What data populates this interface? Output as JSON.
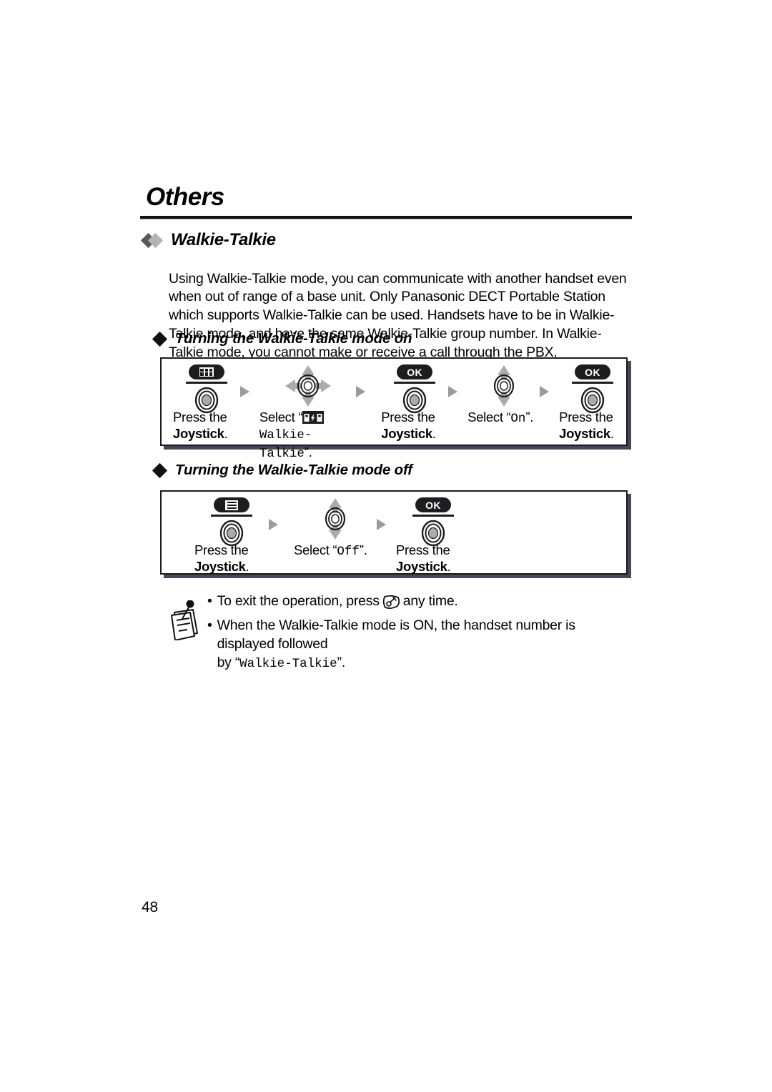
{
  "page": {
    "chapter_title": "Others",
    "page_number": "48"
  },
  "section": {
    "title": "Walkie-Talkie",
    "body": "Using Walkie-Talkie mode, you can communicate with another handset even when out of range of a base unit. Only Panasonic DECT Portable Station which supports Walkie-Talkie can be used. Handsets have to be in Walkie-Talkie mode, and have the same Walkie-Talkie group number. In Walkie-Talkie mode, you cannot make or receive a call through the PBX."
  },
  "procedure_on": {
    "heading": "Turning the Walkie-Talkie mode on",
    "steps": [
      {
        "icon": "menu-grid-button-icon",
        "glyph": "button-joystick",
        "caption_line1": "Press the",
        "caption_line2_bold": "Joystick",
        "caption_line2_tail": "."
      },
      {
        "icon": "joystick-four-arrows-icon",
        "glyph": "joystick-four-way",
        "select_prefix": "Select “",
        "inline_icon": "walkie-talkie-glyph",
        "select_value": "Walkie-Talkie",
        "select_suffix": "”."
      },
      {
        "icon": "ok-button-icon",
        "glyph": "button-joystick",
        "caption_line1": "Press the",
        "caption_line2_bold": "Joystick",
        "caption_line2_tail": "."
      },
      {
        "icon": "joystick-vertical-arrows-icon",
        "glyph": "joystick-vertical",
        "select_prefix": "Select “",
        "select_value": "On",
        "select_suffix": "”."
      },
      {
        "icon": "ok-button-icon",
        "glyph": "button-joystick",
        "caption_line1": "Press the",
        "caption_line2_bold": "Joystick",
        "caption_line2_tail": "."
      }
    ]
  },
  "procedure_off": {
    "heading": "Turning the Walkie-Talkie mode off",
    "steps": [
      {
        "icon": "menu-list-button-icon",
        "glyph": "button-joystick",
        "caption_line1": "Press the",
        "caption_line2_bold": "Joystick",
        "caption_line2_tail": "."
      },
      {
        "icon": "joystick-vertical-arrows-icon",
        "glyph": "joystick-vertical",
        "select_prefix": "Select “",
        "select_value": "Off",
        "select_suffix": "”."
      },
      {
        "icon": "ok-button-icon",
        "glyph": "button-joystick",
        "caption_line1": "Press the",
        "caption_line2_bold": "Joystick",
        "caption_line2_tail": "."
      }
    ]
  },
  "labels": {
    "ok": "OK",
    "bullet": "•"
  },
  "notes": {
    "icon": "memo-note-icon",
    "item1_pre": "To exit the operation, press",
    "item1_icon": "power-off-button-icon",
    "item1_post": "any time.",
    "item2_line1": "When the Walkie-Talkie mode is ON, the handset number is displayed followed",
    "item2_line2_pre": "by “",
    "item2_line2_mono": "Walkie-Talkie",
    "item2_line2_post": "”."
  },
  "colors": {
    "ink": "#000000",
    "box_border": "#1b1b1b",
    "box_shadow": "#4a4458",
    "arrow_gray": "#9b9b9e",
    "diamond_dark": "#58585a",
    "diamond_light": "#b4b4b6",
    "joystick_fill": "#a9abae"
  }
}
